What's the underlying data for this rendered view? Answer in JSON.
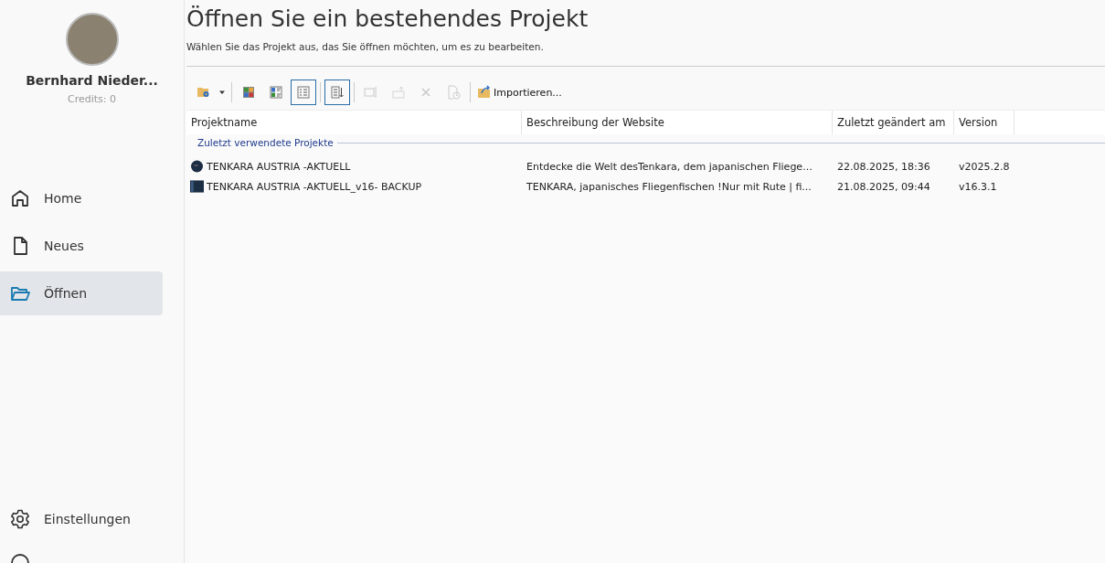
{
  "user": {
    "name": "Bernhard Nieder...",
    "credits": "Credits: 0"
  },
  "nav": [
    {
      "kind": "home",
      "label": "Home",
      "selected": false
    },
    {
      "kind": "new",
      "label": "Neues",
      "selected": false
    },
    {
      "kind": "open",
      "label": "Öffnen",
      "selected": true
    }
  ],
  "nav_bottom": [
    {
      "kind": "settings",
      "label": "Einstellungen",
      "selected": false
    }
  ],
  "page": {
    "title": "Öffnen Sie ein bestehendes Projekt",
    "subtitle": "Wählen Sie das Projekt aus, das Sie öffnen möchten, um es zu bearbeiten."
  },
  "toolbar": [
    [
      {
        "kind": "folder-gear",
        "selected": false,
        "disabled": false
      }
    ],
    [
      {
        "kind": "tiles",
        "selected": false,
        "disabled": false
      },
      {
        "kind": "details",
        "selected": false,
        "disabled": false
      },
      {
        "kind": "list",
        "selected": true,
        "disabled": false
      }
    ],
    [
      {
        "kind": "sort",
        "selected": true,
        "disabled": false
      }
    ],
    [
      {
        "kind": "preview",
        "selected": false,
        "disabled": true
      },
      {
        "kind": "export",
        "selected": false,
        "disabled": true
      },
      {
        "kind": "delete",
        "selected": false,
        "disabled": true
      },
      {
        "kind": "history",
        "selected": false,
        "disabled": true
      }
    ],
    [
      {
        "kind": "import",
        "label": "Importieren...",
        "selected": false,
        "disabled": false
      }
    ]
  ],
  "table": {
    "columns": [
      "Projektname",
      "Beschreibung der Website",
      "Zuletzt geändert am",
      "Version"
    ],
    "group": "Zuletzt verwendete Projekte",
    "rows": [
      {
        "kind": "round",
        "name": "TENKARA AUSTRIA -AKTUELL",
        "description": "Entdecke die Welt desTenkara, dem japanischen Fliege...",
        "modified": "22.08.2025, 18:36",
        "version": "v2025.2.8"
      },
      {
        "kind": "square",
        "name": "TENKARA AUSTRIA -AKTUELL_v16- BACKUP",
        "description": "TENKARA, japanisches Fliegenfischen !Nur mit Rute | fi...",
        "modified": "21.08.2025, 09:44",
        "version": "v16.3.1"
      }
    ]
  }
}
